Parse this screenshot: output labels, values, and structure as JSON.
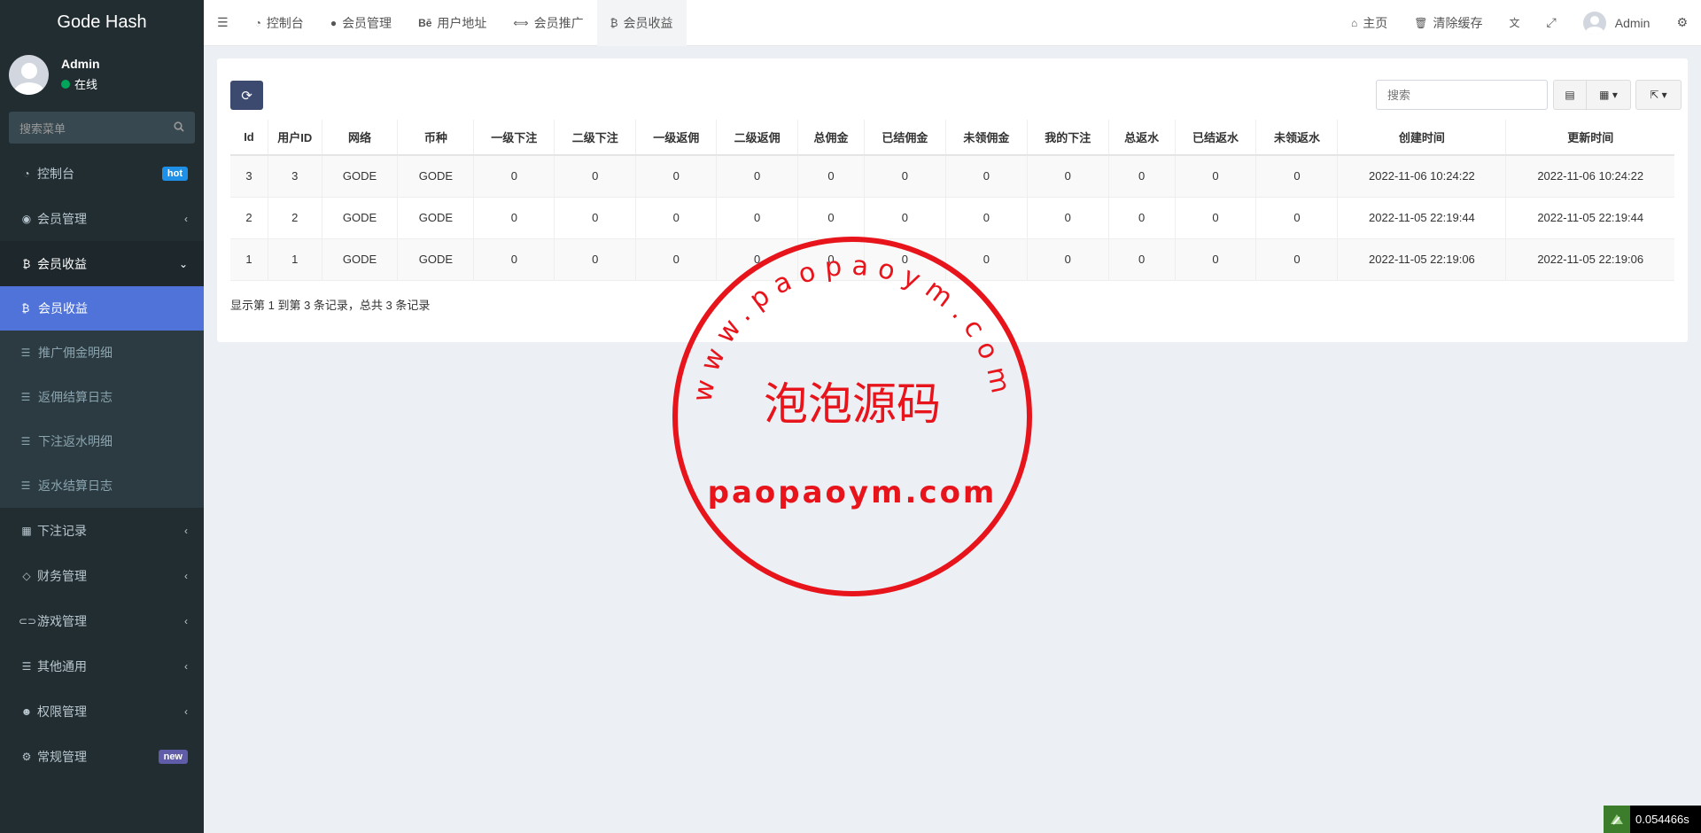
{
  "brand": "Gode Hash",
  "user": {
    "name": "Admin",
    "status": "在线"
  },
  "sidebar_search": {
    "placeholder": "搜索菜单"
  },
  "menu": {
    "dashboard": {
      "label": "控制台",
      "badge": "hot",
      "icon": "dashboard-icon"
    },
    "members": {
      "label": "会员管理",
      "icon": "user-circle-icon"
    },
    "earnings": {
      "label": "会员收益",
      "icon": "bitcoin-icon",
      "items": [
        {
          "label": "会员收益",
          "icon": "bitcoin-icon"
        },
        {
          "label": "推广佣金明细",
          "icon": "list-icon"
        },
        {
          "label": "返佣结算日志",
          "icon": "list-icon"
        },
        {
          "label": "下注返水明细",
          "icon": "list-icon"
        },
        {
          "label": "返水结算日志",
          "icon": "list-icon"
        }
      ]
    },
    "bets": {
      "label": "下注记录",
      "icon": "calendar-icon"
    },
    "finance": {
      "label": "财务管理",
      "icon": "diamond-icon"
    },
    "games": {
      "label": "游戏管理",
      "icon": "gamepad-icon"
    },
    "general": {
      "label": "其他通用",
      "icon": "list-icon"
    },
    "permissions": {
      "label": "权限管理",
      "icon": "users-icon"
    },
    "settings": {
      "label": "常规管理",
      "badge": "new",
      "icon": "cogs-icon"
    }
  },
  "topbar": {
    "tabs": [
      {
        "label": "控制台",
        "icon": "dashboard-icon"
      },
      {
        "label": "会员管理",
        "icon": "user-icon"
      },
      {
        "label": "用户地址",
        "icon": "behance-icon",
        "icon_text": "Bē"
      },
      {
        "label": "会员推广",
        "icon": "handshake-icon"
      },
      {
        "label": "会员收益",
        "icon": "bitcoin-icon"
      }
    ],
    "home": "主页",
    "clear_cache": "清除缓存",
    "admin": "Admin"
  },
  "table": {
    "search_placeholder": "搜索",
    "columns": [
      "Id",
      "用户ID",
      "网络",
      "币种",
      "一级下注",
      "二级下注",
      "一级返佣",
      "二级返佣",
      "总佣金",
      "已结佣金",
      "未领佣金",
      "我的下注",
      "总返水",
      "已结返水",
      "未领返水",
      "创建时间",
      "更新时间"
    ],
    "rows": [
      [
        "3",
        "3",
        "GODE",
        "GODE",
        "0",
        "0",
        "0",
        "0",
        "0",
        "0",
        "0",
        "0",
        "0",
        "0",
        "0",
        "2022-11-06 10:24:22",
        "2022-11-06 10:24:22"
      ],
      [
        "2",
        "2",
        "GODE",
        "GODE",
        "0",
        "0",
        "0",
        "0",
        "0",
        "0",
        "0",
        "0",
        "0",
        "0",
        "0",
        "2022-11-05 22:19:44",
        "2022-11-05 22:19:44"
      ],
      [
        "1",
        "1",
        "GODE",
        "GODE",
        "0",
        "0",
        "0",
        "0",
        "0",
        "0",
        "0",
        "0",
        "0",
        "0",
        "0",
        "2022-11-05 22:19:06",
        "2022-11-05 22:19:06"
      ]
    ],
    "pagination_info": "显示第 1 到第 3 条记录，总共 3 条记录"
  },
  "stamp": {
    "arc_text": "www.paopaoym.com",
    "center_text": "泡泡源码",
    "bottom_text": "paopaoym.com",
    "color": "#e8141b"
  },
  "perf": "0.054466s",
  "colors": {
    "sidebar_bg": "#222d32",
    "active_item": "#4f73d9",
    "refresh_btn": "#3d4a70"
  }
}
